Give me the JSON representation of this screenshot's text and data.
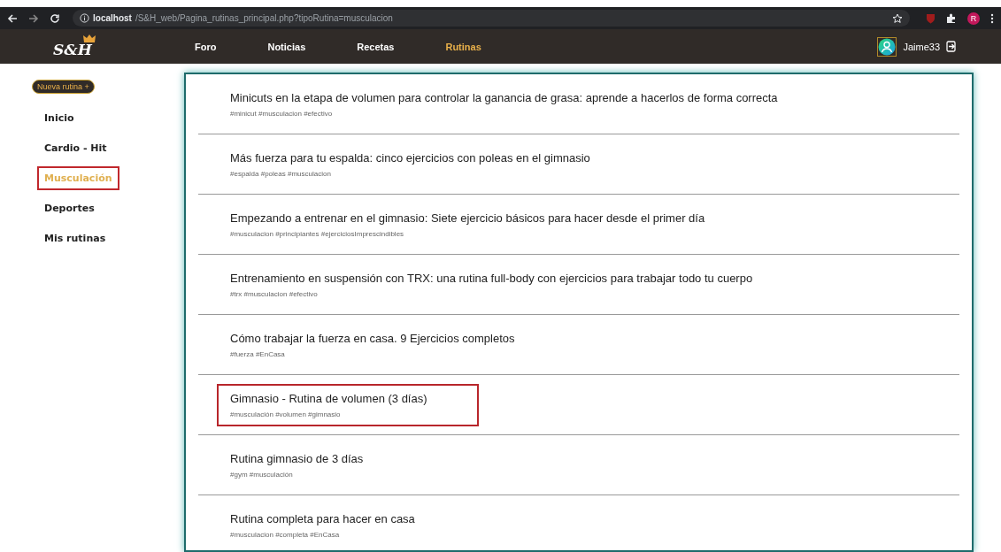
{
  "browser": {
    "url_host": "localhost",
    "url_path": "/S&H_web/Pagina_rutinas_principal.php?tipoRutina=musculacion",
    "profile_initial": "R"
  },
  "navbar": {
    "logo": "S&H",
    "items": [
      {
        "label": "Foro",
        "selected": false
      },
      {
        "label": "Noticias",
        "selected": false
      },
      {
        "label": "Recetas",
        "selected": false
      },
      {
        "label": "Rutinas",
        "selected": true
      }
    ],
    "username": "Jaime33"
  },
  "sidebar": {
    "new_button": "Nueva rutina +",
    "items": [
      {
        "label": "Inicio",
        "selected": false,
        "highlighted": false
      },
      {
        "label": "Cardio - Hit",
        "selected": false,
        "highlighted": false
      },
      {
        "label": "Musculación",
        "selected": true,
        "highlighted": true
      },
      {
        "label": "Deportes",
        "selected": false,
        "highlighted": false
      },
      {
        "label": "Mis rutinas",
        "selected": false,
        "highlighted": false
      }
    ]
  },
  "routines": [
    {
      "title": "Minicuts en la etapa de volumen para controlar la ganancia de grasa: aprende a hacerlos de forma correcta",
      "tags": "#minicut #musculacion #efectivo",
      "highlighted": false
    },
    {
      "title": "Más fuerza para tu espalda: cinco ejercicios con poleas en el gimnasio",
      "tags": "#espalda #poleas #musculacion",
      "highlighted": false
    },
    {
      "title": "Empezando a entrenar en el gimnasio: Siete ejercicio básicos para hacer desde el primer día",
      "tags": "#musculacion #principiantes #ejerciciosImprescindibles",
      "highlighted": false
    },
    {
      "title": "Entrenamiento en suspensión con TRX: una rutina full-body con ejercicios para trabajar todo tu cuerpo",
      "tags": "#trx #musculacion #efectivo",
      "highlighted": false
    },
    {
      "title": "Cómo trabajar la fuerza en casa. 9 Ejercicios completos",
      "tags": "#fuerza #EnCasa",
      "highlighted": false
    },
    {
      "title": "Gimnasio - Rutina de volumen (3 días)",
      "tags": "#musculación #volumen #gimnasio",
      "highlighted": true
    },
    {
      "title": "Rutina gimnasio de 3 días",
      "tags": "#gym #musculación",
      "highlighted": false
    },
    {
      "title": "Rutina completa para hacer en casa",
      "tags": "#musculacion #completa #EnCasa",
      "highlighted": false
    }
  ]
}
